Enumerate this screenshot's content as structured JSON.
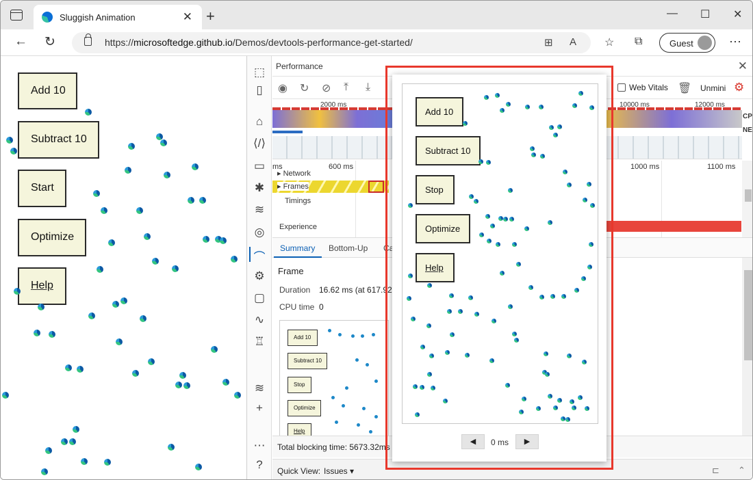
{
  "browser": {
    "tab_title": "Sluggish Animation",
    "url_prefix": "https://",
    "url_host": "microsoftedge.github.io",
    "url_path": "/Demos/devtools-performance-get-started/",
    "guest_label": "Guest"
  },
  "page": {
    "buttons": {
      "add": "Add 10",
      "subtract": "Subtract 10",
      "start": "Start",
      "optimize": "Optimize",
      "help": "Help"
    }
  },
  "devtools": {
    "title": "Performance",
    "web_vitals": "Web Vitals",
    "unminify": "Unmini",
    "overview_ticks": [
      "2000 ms",
      "10000 ms",
      "12000 ms"
    ],
    "overview_labels": {
      "cpu": "CPU",
      "net": "NET"
    },
    "timeline_ticks": [
      "ms",
      "600 ms",
      "1000 ms",
      "1100 ms"
    ],
    "tracks": {
      "network": "Network",
      "frames": "Frames",
      "timings": "Timings",
      "experience": "Experience"
    },
    "summary_tabs": [
      "Summary",
      "Bottom-Up",
      "Ca"
    ],
    "summary": {
      "heading": "Frame",
      "duration_label": "Duration",
      "duration_value": "16.62 ms (at 617.92 r",
      "cpu_label": "CPU time",
      "cpu_value": "0"
    },
    "thumb_buttons": [
      "Add 10",
      "Subtract 10",
      "Stop",
      "Optimize",
      "Help"
    ],
    "blocking": "Total blocking time: 5673.32ms (",
    "quick_view_label": "Quick View:",
    "quick_view_value": "Issues"
  },
  "popup": {
    "buttons": {
      "add": "Add 10",
      "subtract": "Subtract 10",
      "stop": "Stop",
      "optimize": "Optimize",
      "help": "Help"
    },
    "time": "0 ms"
  },
  "colors": {
    "accent": "#0a5fb4",
    "highlight": "#e8382c",
    "button_bg": "#f5f5dc"
  }
}
